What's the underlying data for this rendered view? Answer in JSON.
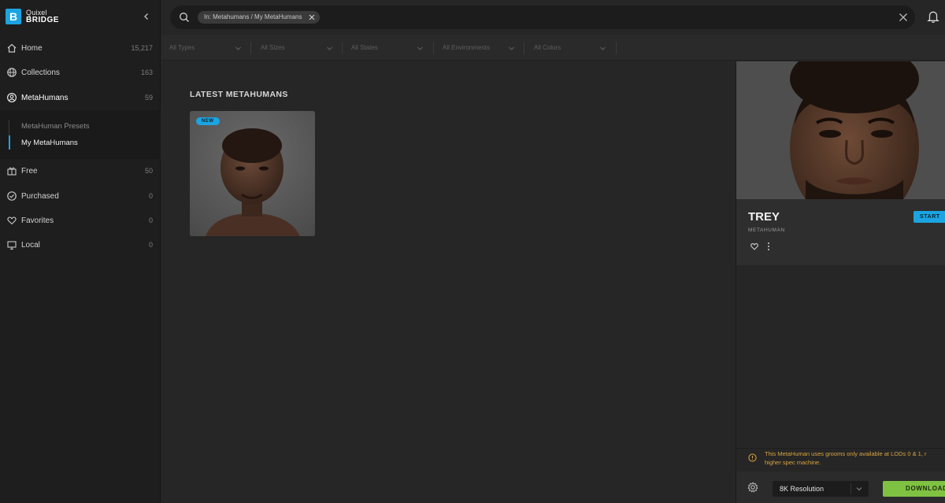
{
  "brand": {
    "top": "Quixel",
    "bottom": "BRIDGE",
    "logo_letter": "B",
    "accent": "#1ba4e1"
  },
  "sidebar": {
    "items": [
      {
        "label": "Home",
        "count": "15,217",
        "icon": "home-icon"
      },
      {
        "label": "Collections",
        "count": "163",
        "icon": "globe-icon"
      },
      {
        "label": "MetaHumans",
        "count": "59",
        "icon": "user-circle-icon"
      },
      {
        "label": "Free",
        "count": "50",
        "icon": "gift-icon"
      },
      {
        "label": "Purchased",
        "count": "0",
        "icon": "check-circle-icon"
      },
      {
        "label": "Favorites",
        "count": "0",
        "icon": "heart-icon"
      },
      {
        "label": "Local",
        "count": "0",
        "icon": "monitor-icon"
      }
    ],
    "subitems": [
      {
        "label": "MetaHuman Presets",
        "active": false
      },
      {
        "label": "My MetaHumans",
        "active": true
      }
    ]
  },
  "search": {
    "chip": "In: Metahumans / My MetaHumans"
  },
  "filters": [
    {
      "label": "All Types"
    },
    {
      "label": "All Sizes"
    },
    {
      "label": "All States"
    },
    {
      "label": "All Environments"
    },
    {
      "label": "All Colors"
    }
  ],
  "main": {
    "section_title": "LATEST METAHUMANS",
    "card": {
      "badge": "NEW"
    }
  },
  "detail": {
    "name": "TREY",
    "type": "METAHUMAN",
    "start_label": "START",
    "warning": [
      "This MetaHuman uses grooms only available at LODs 0 & 1, r",
      "higher spec machine."
    ],
    "resolution": "8K Resolution",
    "download_label": "DOWNLOAD",
    "download_color": "#7fc241",
    "warning_color": "#d9a441"
  }
}
